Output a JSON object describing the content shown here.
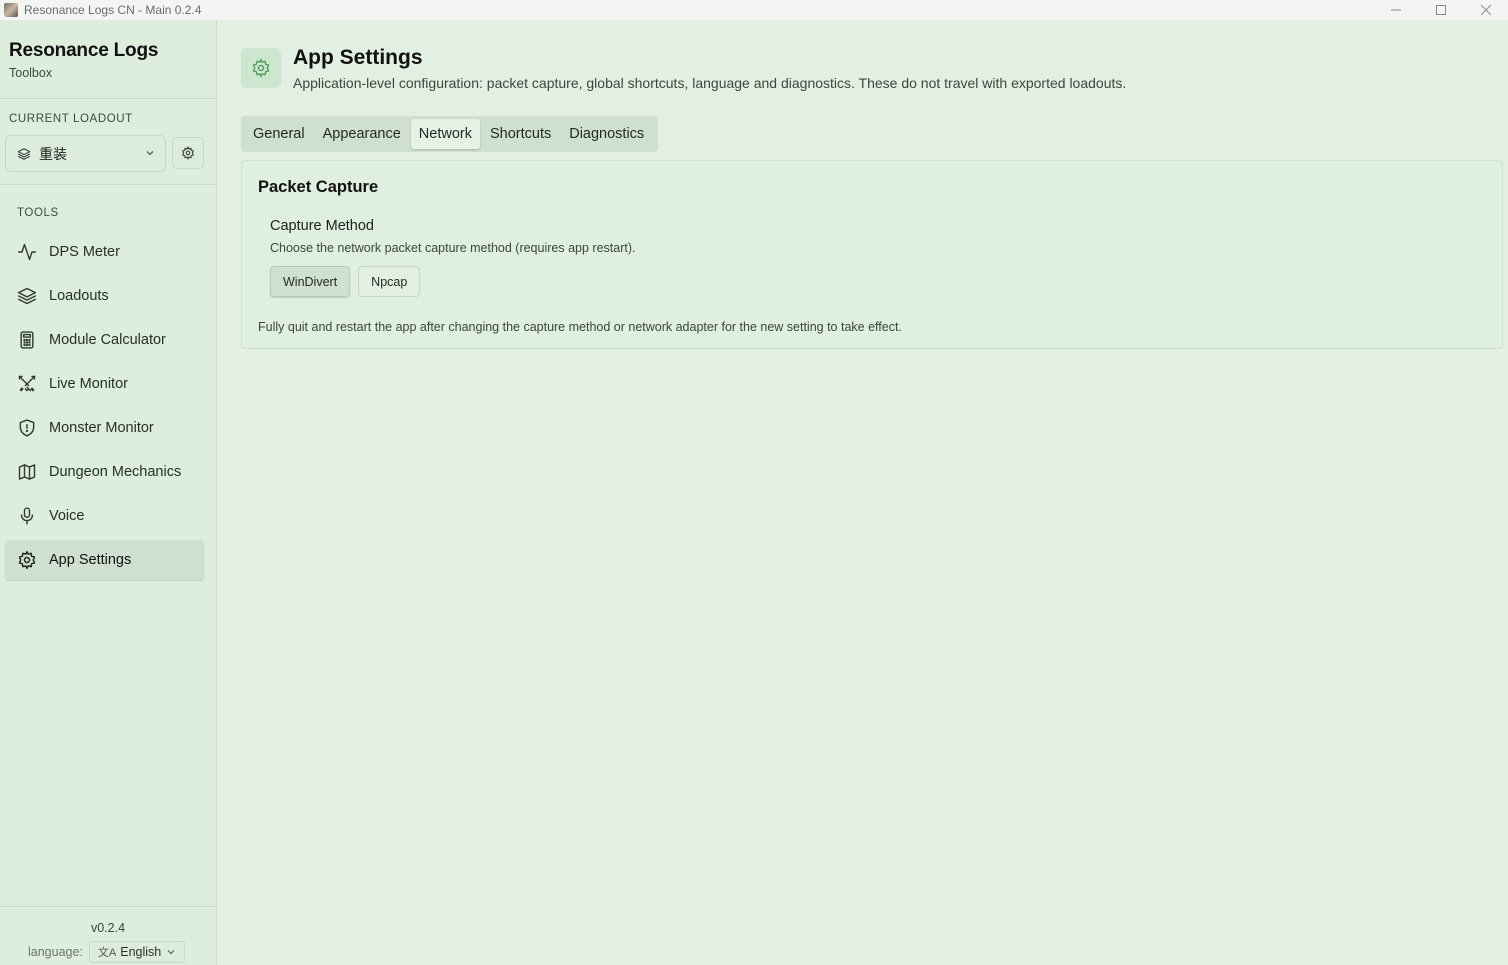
{
  "window": {
    "title": "Resonance Logs CN - Main 0.2.4",
    "controls": [
      "minimize-icon",
      "maximize-icon",
      "close-icon"
    ]
  },
  "sidebar": {
    "brand_title": "Resonance Logs",
    "brand_subtitle": "Toolbox",
    "loadout_label": "CURRENT LOADOUT",
    "loadout_value": "重装",
    "tools_label": "TOOLS",
    "items": [
      {
        "label": "DPS Meter",
        "icon": "activity-icon"
      },
      {
        "label": "Loadouts",
        "icon": "layers-icon"
      },
      {
        "label": "Module Calculator",
        "icon": "calculator-icon"
      },
      {
        "label": "Live Monitor",
        "icon": "swords-icon"
      },
      {
        "label": "Monster Monitor",
        "icon": "shield-icon"
      },
      {
        "label": "Dungeon Mechanics",
        "icon": "map-icon"
      },
      {
        "label": "Voice",
        "icon": "microphone-icon"
      },
      {
        "label": "App Settings",
        "icon": "gear-icon",
        "active": true
      }
    ],
    "version": "v0.2.4",
    "language_label": "language:",
    "language_value": "English"
  },
  "header": {
    "title": "App Settings",
    "description": "Application-level configuration: packet capture, global shortcuts, language and diagnostics. These do not travel with exported loadouts."
  },
  "tabs": [
    {
      "label": "General"
    },
    {
      "label": "Appearance"
    },
    {
      "label": "Network",
      "active": true
    },
    {
      "label": "Shortcuts"
    },
    {
      "label": "Diagnostics"
    }
  ],
  "packet_capture": {
    "title": "Packet Capture",
    "field_label": "Capture Method",
    "field_help": "Choose the network packet capture method (requires app restart).",
    "options": [
      {
        "label": "WinDivert",
        "selected": true
      },
      {
        "label": "Npcap",
        "selected": false
      }
    ],
    "note": "Fully quit and restart the app after changing the capture method or network adapter for the new setting to take effect."
  },
  "colors": {
    "background": "#e1f0e2",
    "sidebar": "#ddeedd",
    "accent_icon": "#4f9a5c"
  }
}
